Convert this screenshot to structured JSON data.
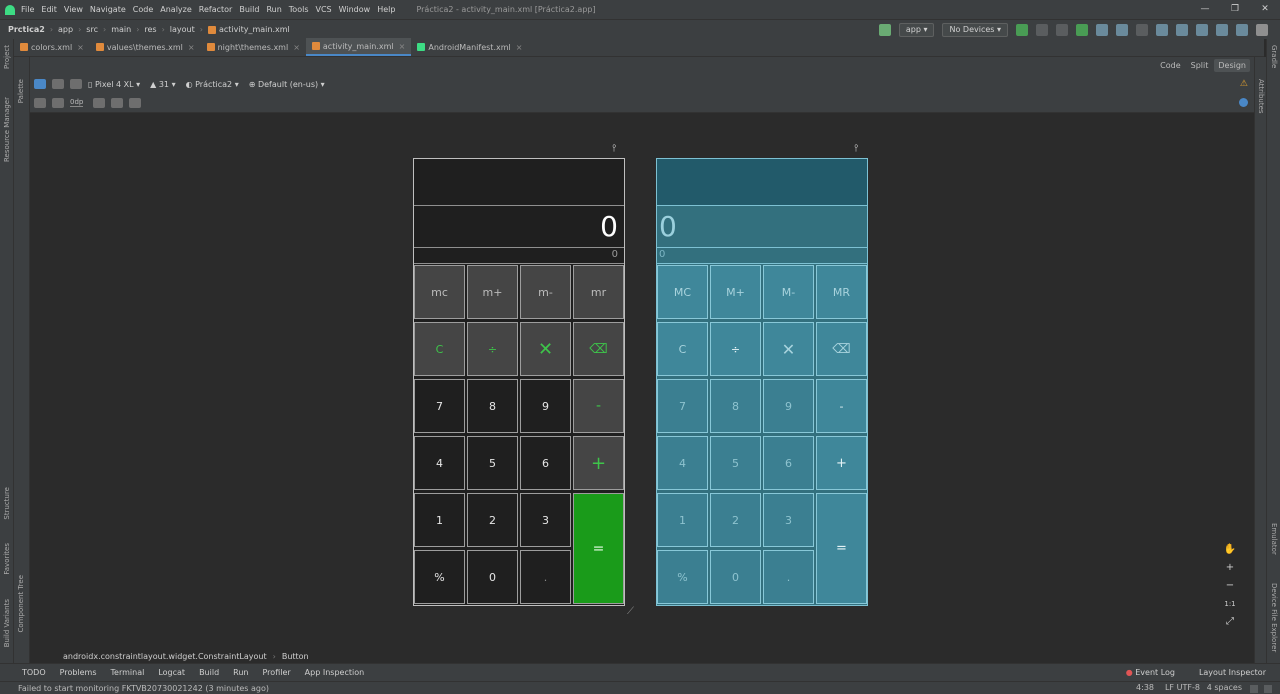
{
  "window": {
    "title": "Práctica2 - activity_main.xml [Práctica2.app]",
    "menu": [
      "File",
      "Edit",
      "View",
      "Navigate",
      "Code",
      "Analyze",
      "Refactor",
      "Build",
      "Run",
      "Tools",
      "VCS",
      "Window",
      "Help"
    ],
    "controls": {
      "minimize": "—",
      "restore": "❐",
      "close": "✕"
    }
  },
  "navbar": {
    "breadcrumbs": [
      "Prctica2",
      "app",
      "src",
      "main",
      "res",
      "layout",
      "activity_main.xml"
    ],
    "run_config": "app",
    "device": "No Devices"
  },
  "tabs": [
    {
      "label": "colors.xml",
      "active": false
    },
    {
      "label": "values\\themes.xml",
      "active": false
    },
    {
      "label": "night\\themes.xml",
      "active": false
    },
    {
      "label": "activity_main.xml",
      "active": true
    },
    {
      "label": "AndroidManifest.xml",
      "active": false
    }
  ],
  "tab_close": "×",
  "modes": {
    "code": "Code",
    "split": "Split",
    "design": "Design"
  },
  "design_toolbar": {
    "device": "Pixel 4 XL",
    "api": "31",
    "theme": "Práctica2",
    "locale": "Default (en-us)",
    "dp": "0dp"
  },
  "left_tools": [
    "Project",
    "Resource Manager",
    "Structure",
    "Favorites",
    "Build Variants"
  ],
  "left_tools_inner": [
    "Palette",
    "Component Tree"
  ],
  "right_tools": [
    "Gradle",
    "Emulator",
    "Device File Explorer"
  ],
  "right_tools_inner": [
    "Attributes",
    "Layout Validation"
  ],
  "calc_light": {
    "display": "0",
    "sub": "0",
    "mem_row": [
      "mc",
      "m+",
      "m-",
      "mr"
    ],
    "op_row": [
      "C",
      "÷",
      "✕",
      "⌫"
    ],
    "row1": [
      "7",
      "8",
      "9",
      "-"
    ],
    "row2": [
      "4",
      "5",
      "6",
      "+"
    ],
    "row3": [
      "1",
      "2",
      "3"
    ],
    "row4": [
      "%",
      "0",
      "."
    ],
    "equals": "="
  },
  "calc_dark": {
    "display": "0",
    "sub": "0",
    "mem_row": [
      "MC",
      "M+",
      "M-",
      "MR"
    ],
    "op_row": [
      "C",
      "÷",
      "✕",
      "⌫"
    ],
    "row1": [
      "7",
      "8",
      "9",
      "-"
    ],
    "row2": [
      "4",
      "5",
      "6",
      "+"
    ],
    "row3": [
      "1",
      "2",
      "3"
    ],
    "row4": [
      "%",
      "0",
      "."
    ],
    "equals": "="
  },
  "path": [
    "androidx.constraintlayout.widget.ConstraintLayout",
    "Button"
  ],
  "zoom_tools": [
    "✋",
    "+",
    "−",
    "1:1",
    "⤢"
  ],
  "bottom_tools": [
    "TODO",
    "Problems",
    "Terminal",
    "Logcat",
    "Build",
    "Run",
    "Profiler",
    "App Inspection"
  ],
  "bottom_right_tools": [
    "Event Log",
    "Layout Inspector"
  ],
  "status": {
    "message": "Failed to start monitoring FKTVB20730021242 (3 minutes ago)",
    "position": "4:38",
    "line_sep": "LF",
    "encoding": "UTF-8",
    "indent": "4 spaces"
  },
  "colors": {
    "accent_green": "#1a9b1a",
    "dark_device_bg": "#33707e",
    "ide_bg": "#2b2b2b"
  }
}
